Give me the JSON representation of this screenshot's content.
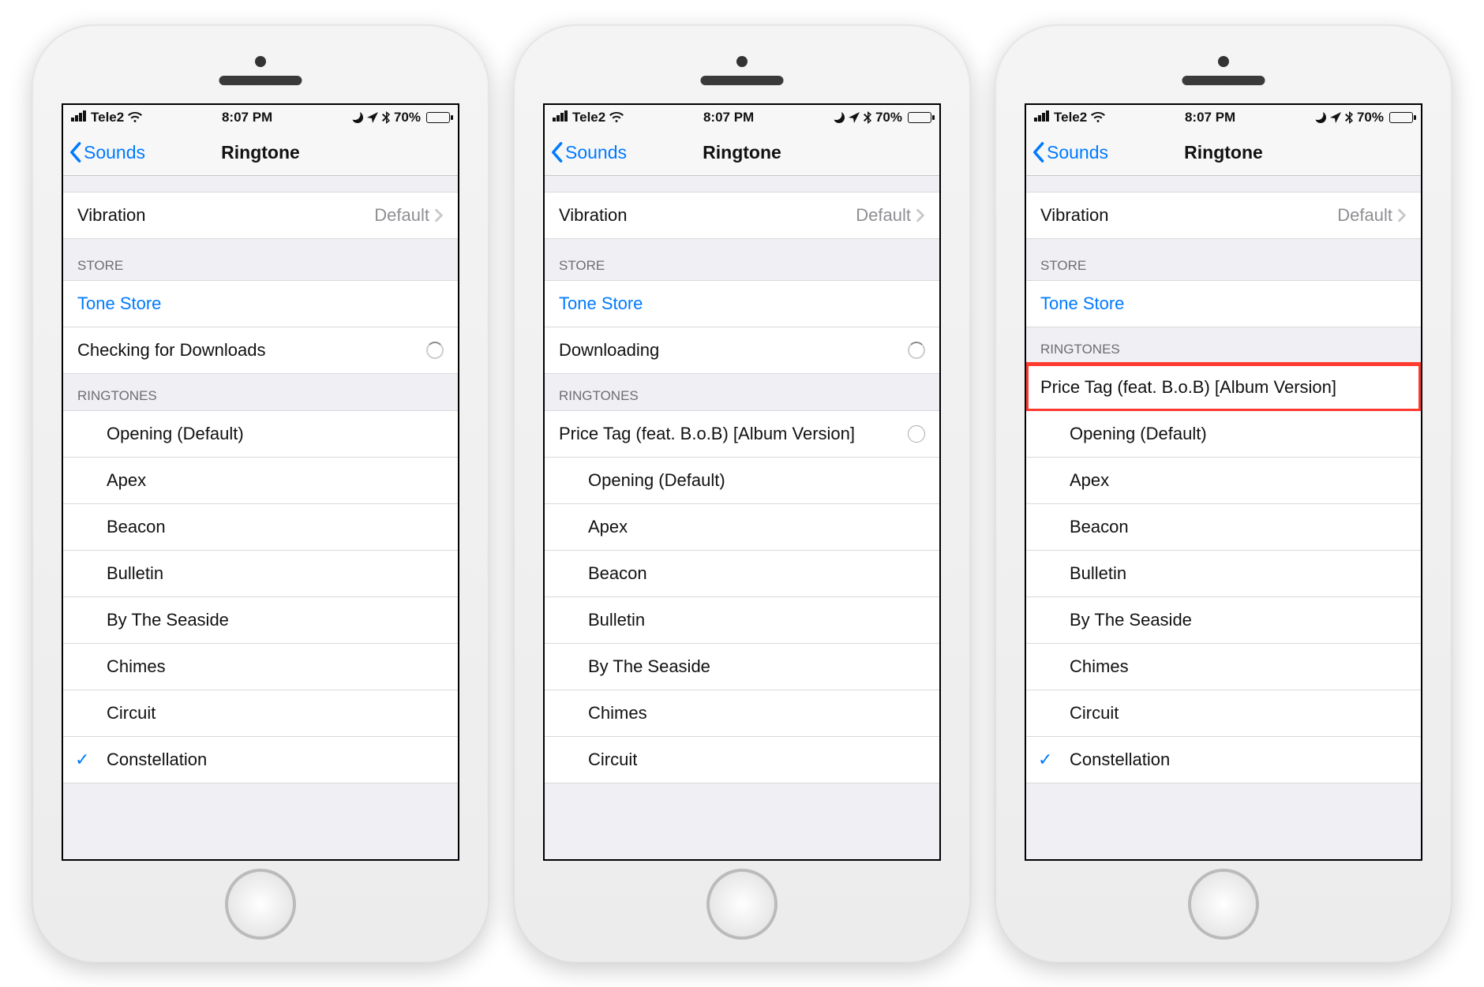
{
  "status": {
    "carrier": "Tele2",
    "time": "8:07 PM",
    "battery_pct": "70%"
  },
  "nav": {
    "back_label": "Sounds",
    "title": "Ringtone"
  },
  "vibration": {
    "label": "Vibration",
    "value": "Default"
  },
  "section_store": "STORE",
  "tone_store": "Tone Store",
  "section_ringtones": "RINGTONES",
  "screens": [
    {
      "store_status": "Checking for Downloads",
      "show_spinner": true,
      "custom_tone": null,
      "ringtones": [
        {
          "label": "Opening (Default)",
          "checked": false
        },
        {
          "label": "Apex",
          "checked": false
        },
        {
          "label": "Beacon",
          "checked": false
        },
        {
          "label": "Bulletin",
          "checked": false
        },
        {
          "label": "By The Seaside",
          "checked": false
        },
        {
          "label": "Chimes",
          "checked": false
        },
        {
          "label": "Circuit",
          "checked": false
        },
        {
          "label": "Constellation",
          "checked": true
        }
      ]
    },
    {
      "store_status": "Downloading",
      "show_spinner": true,
      "custom_tone": {
        "label": "Price Tag (feat. B.o.B) [Album Version]",
        "progress_circle": true,
        "highlight": false
      },
      "ringtones": [
        {
          "label": "Opening (Default)",
          "checked": false
        },
        {
          "label": "Apex",
          "checked": false
        },
        {
          "label": "Beacon",
          "checked": false
        },
        {
          "label": "Bulletin",
          "checked": false
        },
        {
          "label": "By The Seaside",
          "checked": false
        },
        {
          "label": "Chimes",
          "checked": false
        },
        {
          "label": "Circuit",
          "checked": false
        }
      ]
    },
    {
      "store_status": null,
      "show_spinner": false,
      "custom_tone": {
        "label": "Price Tag (feat. B.o.B) [Album Version]",
        "progress_circle": false,
        "highlight": true
      },
      "ringtones": [
        {
          "label": "Opening (Default)",
          "checked": false
        },
        {
          "label": "Apex",
          "checked": false
        },
        {
          "label": "Beacon",
          "checked": false
        },
        {
          "label": "Bulletin",
          "checked": false
        },
        {
          "label": "By The Seaside",
          "checked": false
        },
        {
          "label": "Chimes",
          "checked": false
        },
        {
          "label": "Circuit",
          "checked": false
        },
        {
          "label": "Constellation",
          "checked": true
        }
      ]
    }
  ]
}
